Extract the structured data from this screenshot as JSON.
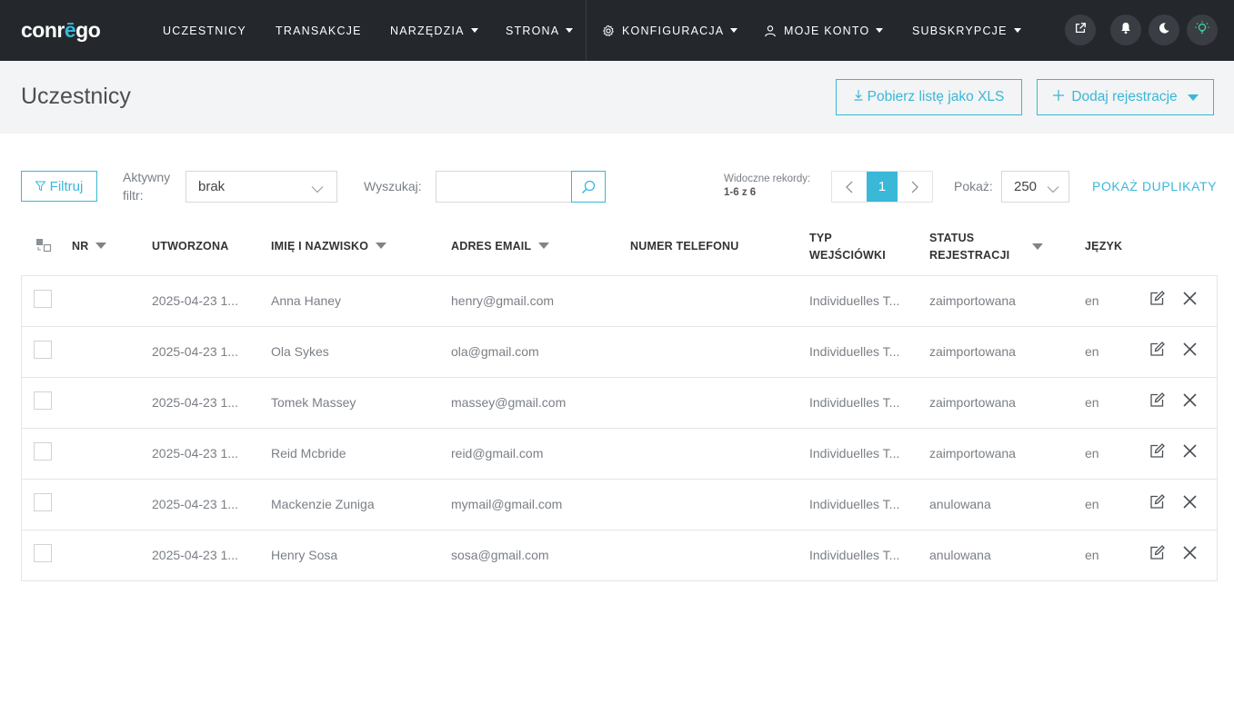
{
  "app": {
    "logo_main": "conr",
    "logo_accent": "ē",
    "logo_rest": "go"
  },
  "nav": {
    "items": [
      {
        "label": "UCZESTNICY"
      },
      {
        "label": "TRANSAKCJE"
      },
      {
        "label": "NARZĘDZIA"
      },
      {
        "label": "STRONA"
      },
      {
        "label": "KONFIGURACJA"
      },
      {
        "label": "MOJE KONTO"
      },
      {
        "label": "SUBSKRYPCJE"
      }
    ]
  },
  "page": {
    "title": "Uczestnicy",
    "download_label": "Pobierz listę jako XLS",
    "add_label": "Dodaj rejestracje"
  },
  "toolbar": {
    "filter_label": "Filtruj",
    "active_filter_label_1": "Aktywny",
    "active_filter_label_2": "filtr:",
    "active_filter_value": "brak",
    "search_label": "Wyszukaj:",
    "search_value": "",
    "records_label": "Widoczne rekordy:",
    "records_value": "1-6 z 6",
    "current_page": "1",
    "show_label": "Pokaż:",
    "show_value": "250",
    "duplicates_label": "POKAŻ DUPLIKATY"
  },
  "table": {
    "headers": {
      "nr": "NR",
      "created": "UTWORZONA",
      "name": "IMIĘ I NAZWISKO",
      "email": "ADRES EMAIL",
      "phone": "NUMER TELEFONU",
      "ticket_1": "TYP",
      "ticket_2": "WEJŚCIÓWKI",
      "status_1": "STATUS",
      "status_2": "REJESTRACJI",
      "lang": "JĘZYK"
    },
    "rows": [
      {
        "created": "2025-04-23 1...",
        "name": "Anna Haney",
        "email": "henry@gmail.com",
        "phone": "",
        "ticket": "Individuelles T...",
        "status": "zaimportowana",
        "lang": "en"
      },
      {
        "created": "2025-04-23 1...",
        "name": "Ola Sykes",
        "email": "ola@gmail.com",
        "phone": "",
        "ticket": "Individuelles T...",
        "status": "zaimportowana",
        "lang": "en"
      },
      {
        "created": "2025-04-23 1...",
        "name": "Tomek Massey",
        "email": "massey@gmail.com",
        "phone": "",
        "ticket": "Individuelles T...",
        "status": "zaimportowana",
        "lang": "en"
      },
      {
        "created": "2025-04-23 1...",
        "name": "Reid Mcbride",
        "email": "reid@gmail.com",
        "phone": "",
        "ticket": "Individuelles T...",
        "status": "zaimportowana",
        "lang": "en"
      },
      {
        "created": "2025-04-23 1...",
        "name": "Mackenzie Zuniga",
        "email": "mymail@gmail.com",
        "phone": "",
        "ticket": "Individuelles T...",
        "status": "anulowana",
        "lang": "en"
      },
      {
        "created": "2025-04-23 1...",
        "name": "Henry Sosa",
        "email": "sosa@gmail.com",
        "phone": "",
        "ticket": "Individuelles T...",
        "status": "anulowana",
        "lang": "en"
      }
    ]
  },
  "icons": {
    "settings": "gear-icon",
    "account": "user-icon",
    "external": "external-link-icon",
    "notifications": "bell-icon",
    "dark_mode": "moon-icon",
    "light_mode": "sun-icon",
    "download": "download-icon",
    "add": "plus-icon",
    "filter": "funnel-icon",
    "search": "search-icon",
    "edit": "edit-icon",
    "delete": "close-icon"
  },
  "colors": {
    "accent": "#39b8d8",
    "navbar": "#24272c",
    "header_bg": "#f3f4f5"
  }
}
